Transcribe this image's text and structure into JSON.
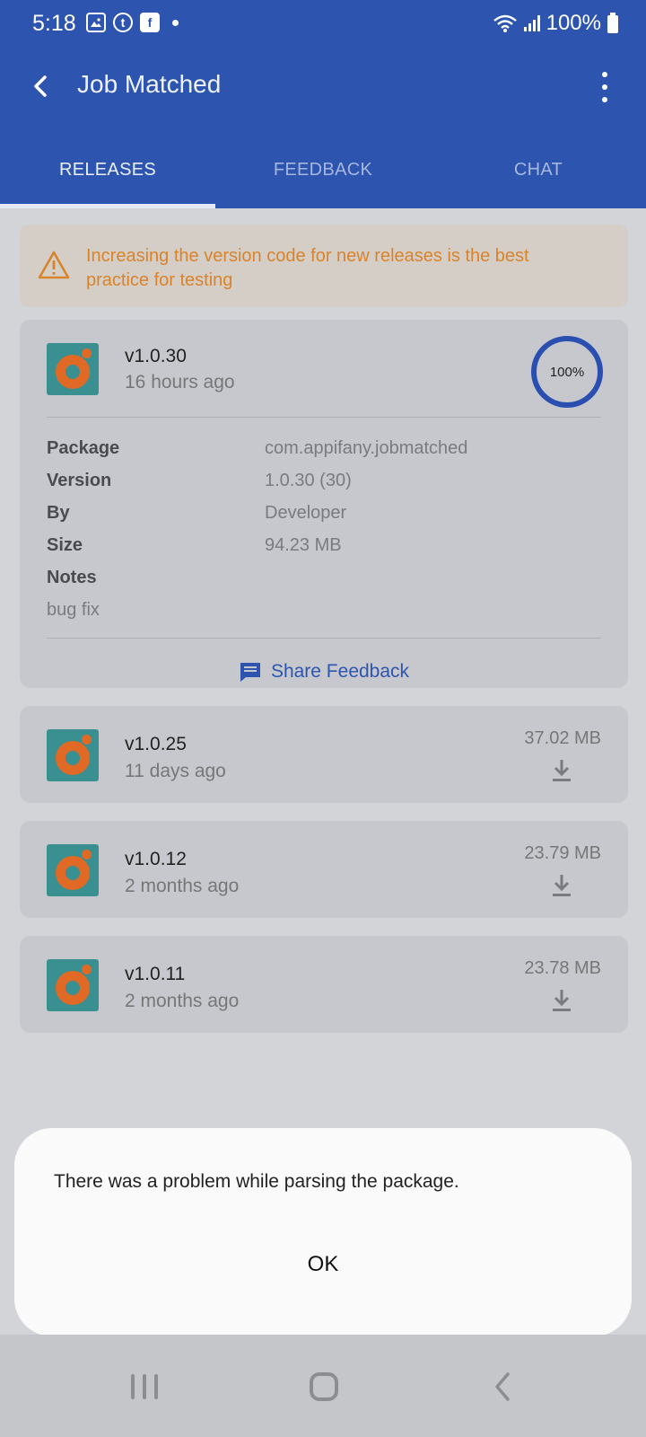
{
  "status_bar": {
    "time": "5:18",
    "battery": "100%",
    "icons": [
      "image-icon",
      "tumblr-icon",
      "facebook-icon",
      "dot-icon",
      "wifi-icon",
      "signal-icon",
      "battery-icon"
    ]
  },
  "header": {
    "title": "Job Matched",
    "accent_color": "#2d55b0"
  },
  "tabs": [
    {
      "label": "RELEASES",
      "active": true
    },
    {
      "label": "FEEDBACK",
      "active": false
    },
    {
      "label": "CHAT",
      "active": false
    }
  ],
  "warning": {
    "text": "Increasing the version code for new releases is the best practice for testing",
    "color": "#d9832a"
  },
  "latest_release": {
    "version": "v1.0.30",
    "time_ago": "16 hours ago",
    "progress": "100%",
    "details": [
      {
        "label": "Package",
        "value": "com.appifany.jobmatched"
      },
      {
        "label": "Version",
        "value": "1.0.30 (30)"
      },
      {
        "label": "By",
        "value": "Developer"
      },
      {
        "label": "Size",
        "value": "94.23 MB"
      }
    ],
    "notes_label": "Notes",
    "notes": "bug fix",
    "share_label": "Share Feedback"
  },
  "releases": [
    {
      "version": "v1.0.25",
      "time_ago": "11 days ago",
      "size": "37.02 MB"
    },
    {
      "version": "v1.0.12",
      "time_ago": "2 months ago",
      "size": "23.79 MB"
    },
    {
      "version": "v1.0.11",
      "time_ago": "2 months ago",
      "size": "23.78 MB"
    }
  ],
  "dialog": {
    "message": "There was a problem while parsing the package.",
    "ok_label": "OK"
  }
}
